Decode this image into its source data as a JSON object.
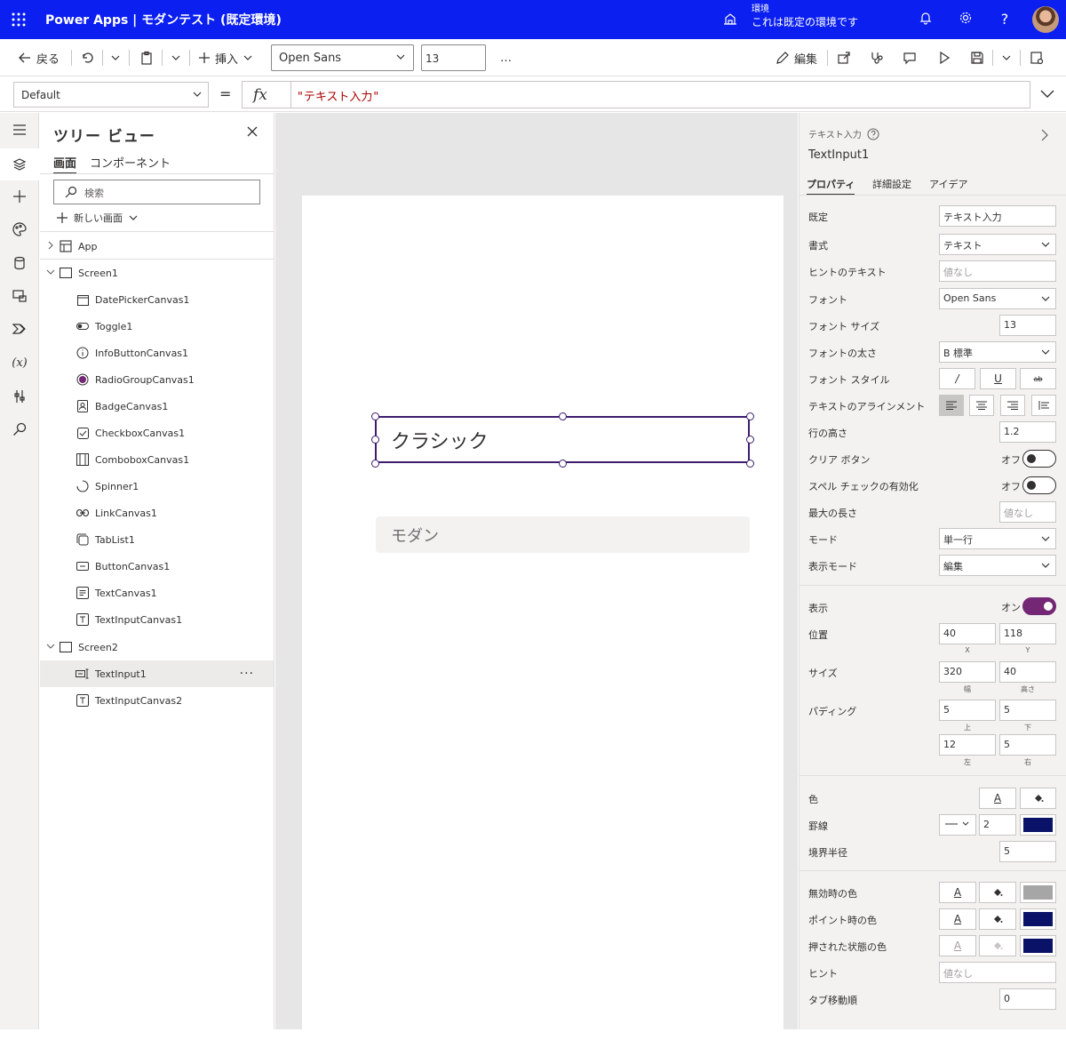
{
  "topbar": {
    "app_title": "Power Apps",
    "separator": "|",
    "project_title": "モダンテスト (既定環境)",
    "env_label": "環境",
    "env_name": "これは既定の環境です"
  },
  "cmdbar": {
    "back": "戻る",
    "insert": "挿入",
    "font": "Open Sans",
    "font_size": "13",
    "more": "…",
    "edit": "編集"
  },
  "formula_bar": {
    "property": "Default",
    "equals": "=",
    "fx": "fx",
    "formula": "\"テキスト入力\""
  },
  "tree": {
    "title": "ツリー ビュー",
    "tabs": [
      "画面",
      "コンポーネント"
    ],
    "search_placeholder": "検索",
    "new_screen": "新しい画面",
    "items": [
      {
        "label": "App"
      },
      {
        "label": "Screen1"
      },
      {
        "label": "DatePickerCanvas1"
      },
      {
        "label": "Toggle1"
      },
      {
        "label": "InfoButtonCanvas1"
      },
      {
        "label": "RadioGroupCanvas1"
      },
      {
        "label": "BadgeCanvas1"
      },
      {
        "label": "CheckboxCanvas1"
      },
      {
        "label": "ComboboxCanvas1"
      },
      {
        "label": "Spinner1"
      },
      {
        "label": "LinkCanvas1"
      },
      {
        "label": "TabList1"
      },
      {
        "label": "ButtonCanvas1"
      },
      {
        "label": "TextCanvas1"
      },
      {
        "label": "TextInputCanvas1"
      },
      {
        "label": "Screen2"
      },
      {
        "label": "TextInput1"
      },
      {
        "label": "TextInputCanvas2"
      }
    ],
    "more": "···"
  },
  "canvas": {
    "classic_text": "クラシック",
    "modern_placeholder": "モダン"
  },
  "props": {
    "type": "テキスト入力",
    "name": "TextInput1",
    "tabs": [
      "プロパティ",
      "詳細設定",
      "アイデア"
    ],
    "labels": {
      "default": "既定",
      "format": "書式",
      "hint_text": "ヒントのテキスト",
      "font": "フォント",
      "font_size": "フォント サイズ",
      "font_weight": "フォントの太さ",
      "font_style": "フォント スタイル",
      "align": "テキストのアラインメント",
      "line_height": "行の高さ",
      "clear_button": "クリア ボタン",
      "spellcheck": "スペル チェックの有効化",
      "max_length": "最大の長さ",
      "mode": "モード",
      "display_mode": "表示モード",
      "visible": "表示",
      "position": "位置",
      "size": "サイズ",
      "padding": "パディング",
      "color": "色",
      "border": "罫線",
      "border_radius": "境界半径",
      "disabled_color": "無効時の色",
      "hover_color": "ポイント時の色",
      "pressed_color": "押された状態の色",
      "tooltip": "ヒント",
      "tab_index": "タブ移動順"
    },
    "values": {
      "default": "テキスト入力",
      "format": "テキスト",
      "hint_text": "値なし",
      "font": "Open Sans",
      "font_size": "13",
      "font_weight": "B  標準",
      "line_height": "1.2",
      "clear_button": "オフ",
      "spellcheck": "オフ",
      "max_length": "値なし",
      "mode": "単一行",
      "display_mode": "編集",
      "visible": "オン",
      "x": "40",
      "y": "118",
      "width": "320",
      "height": "40",
      "pad_top": "5",
      "pad_bottom": "5",
      "pad_left": "12",
      "pad_right": "5",
      "border_width": "2",
      "border_radius": "5",
      "tooltip": "値なし",
      "tab_index": "0",
      "font_style_italic": "/",
      "font_style_underline": "U",
      "font_style_strike": "ab",
      "color_letter": "A"
    },
    "sublabels": {
      "x": "X",
      "y": "Y",
      "width": "幅",
      "height": "高さ",
      "top": "上",
      "bottom": "下",
      "left": "左",
      "right": "右"
    },
    "colors": {
      "border": "#0a1268",
      "disabled_fill": "#a6a6a6",
      "hover_fill": "#0a1268",
      "pressed_fill": "#0a1268",
      "toggle_on": "#742774",
      "brand": "#0b1ff0"
    }
  }
}
